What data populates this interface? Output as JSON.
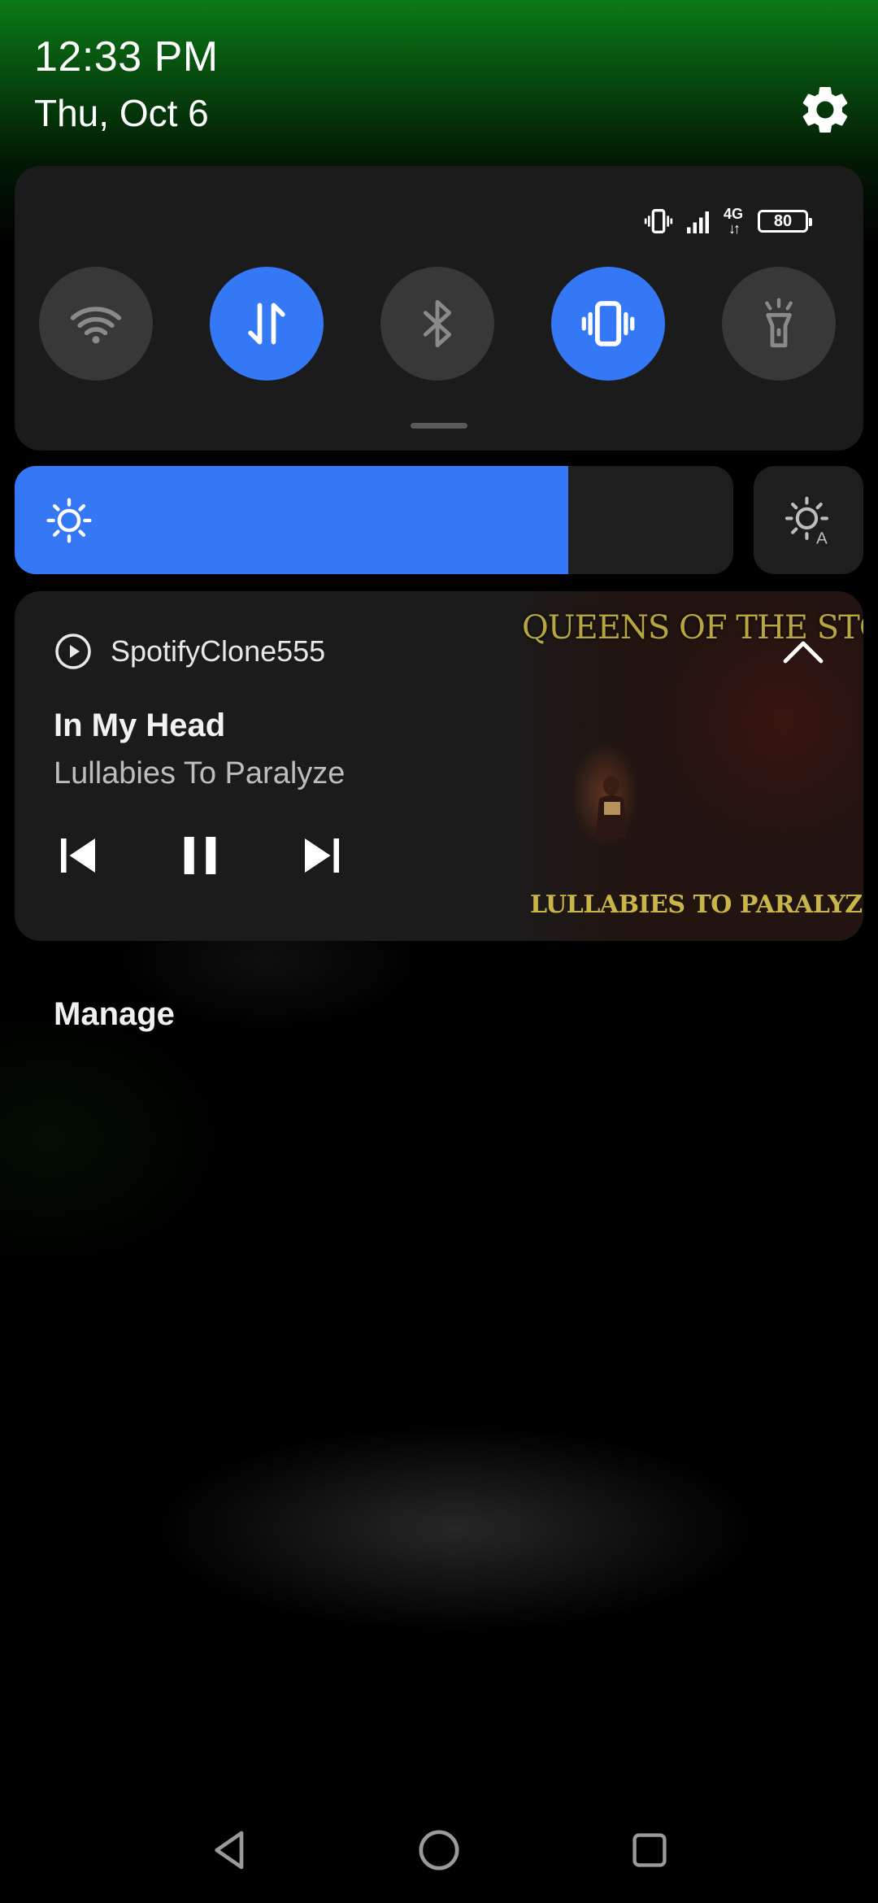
{
  "header": {
    "time": "12:33 PM",
    "date": "Thu, Oct 6",
    "settings_icon": "gear-icon"
  },
  "status_bar": {
    "network_type": "4G",
    "battery_level": "80",
    "icons": [
      "vibrate-icon",
      "signal-icon",
      "data-arrows-icon",
      "battery-icon"
    ]
  },
  "quick_tiles": [
    {
      "name": "wifi",
      "icon": "wifi-icon",
      "active": false
    },
    {
      "name": "mobile-data",
      "icon": "data-transfer-icon",
      "active": true
    },
    {
      "name": "bluetooth",
      "icon": "bluetooth-icon",
      "active": false
    },
    {
      "name": "vibrate",
      "icon": "vibrate-icon",
      "active": true
    },
    {
      "name": "flashlight",
      "icon": "flashlight-icon",
      "active": false
    }
  ],
  "brightness": {
    "level": 0.77,
    "icon": "sun-icon",
    "auto_icon": "auto-brightness-icon"
  },
  "media": {
    "app_name": "SpotifyClone555",
    "song_title": "In My Head",
    "album": "Lullabies To Paralyze",
    "album_art_text_top": "QUEENS OF THE STONE AGE",
    "album_art_text_bottom": "LULLABIES TO PARALYZE",
    "controls": [
      "previous-icon",
      "pause-icon",
      "next-icon"
    ],
    "accent_color": "#3478f6"
  },
  "manage_label": "Manage",
  "navigation": [
    "back-icon",
    "home-icon",
    "recents-icon"
  ]
}
